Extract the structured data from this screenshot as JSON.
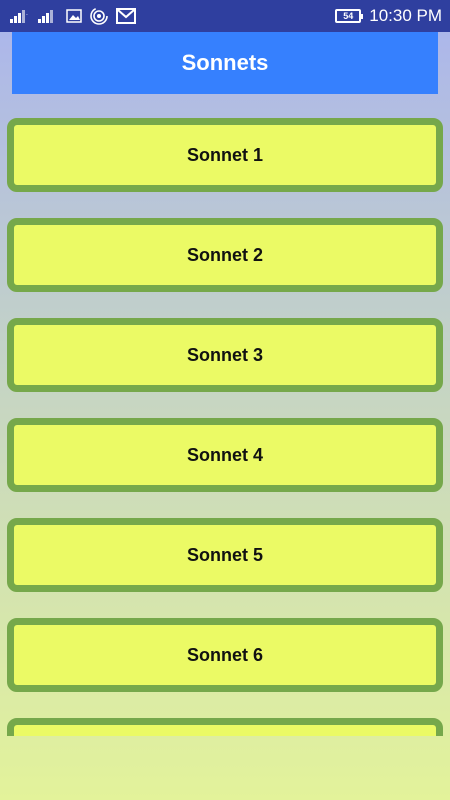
{
  "status_bar": {
    "battery": "54",
    "time": "10:30 PM"
  },
  "app_bar": {
    "title": "Sonnets"
  },
  "sonnets": [
    {
      "label": "Sonnet 1"
    },
    {
      "label": "Sonnet 2"
    },
    {
      "label": "Sonnet 3"
    },
    {
      "label": "Sonnet 4"
    },
    {
      "label": "Sonnet 5"
    },
    {
      "label": "Sonnet 6"
    },
    {
      "label": ""
    }
  ],
  "colors": {
    "status_bar": "#2f3f9f",
    "app_bar": "#3680fe",
    "button_fill": "#ebfa65",
    "button_border": "#76a84b"
  }
}
